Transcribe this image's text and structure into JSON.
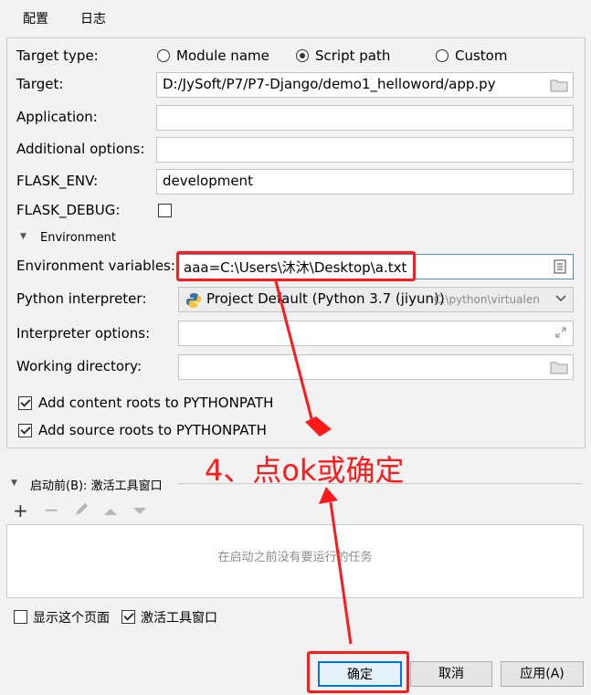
{
  "tabs": [
    "配置",
    "日志"
  ],
  "target_type": {
    "label": "Target type:",
    "options": [
      "Module name",
      "Script path",
      "Custom"
    ],
    "selected": "Script path"
  },
  "target": {
    "label": "Target:",
    "value": "D:/JySoft/P7/P7-Django/demo1_helloword/app.py"
  },
  "application": {
    "label": "Application:",
    "value": ""
  },
  "additional_options": {
    "label": "Additional options:",
    "value": ""
  },
  "flask_env": {
    "label": "FLASK_ENV:",
    "value": "development"
  },
  "flask_debug": {
    "label": "FLASK_DEBUG:",
    "checked": false
  },
  "environment_section": "Environment",
  "env_vars": {
    "label": "Environment variables:",
    "value": "aaa=C:\\Users\\沐沐\\Desktop\\a.txt"
  },
  "python_interpreter": {
    "label": "Python interpreter:",
    "value": "Project Default (Python 3.7 (jiyun))",
    "path": "C:\\python\\virtualen"
  },
  "interpreter_options": {
    "label": "Interpreter options:",
    "value": ""
  },
  "working_directory": {
    "label": "Working directory:",
    "value": ""
  },
  "add_content_roots": {
    "label": "Add content roots to PYTHONPATH",
    "checked": true
  },
  "add_source_roots": {
    "label": "Add source roots to PYTHONPATH",
    "checked": true
  },
  "before_launch": {
    "label": "启动前(B): 激活工具窗口",
    "empty_text": "在启动之前没有要运行的任务"
  },
  "annotation": "4、点ok或确定",
  "show_page": {
    "label": "显示这个页面",
    "checked": false
  },
  "activate_tool_window": {
    "label": "激活工具窗口",
    "checked": true
  },
  "buttons": {
    "ok": "确定",
    "cancel": "取消",
    "apply": "应用(A)"
  },
  "colors": {
    "accent": "#4083c9",
    "annotation_red": "#ff1a1a",
    "background": "#f2f2f2"
  }
}
